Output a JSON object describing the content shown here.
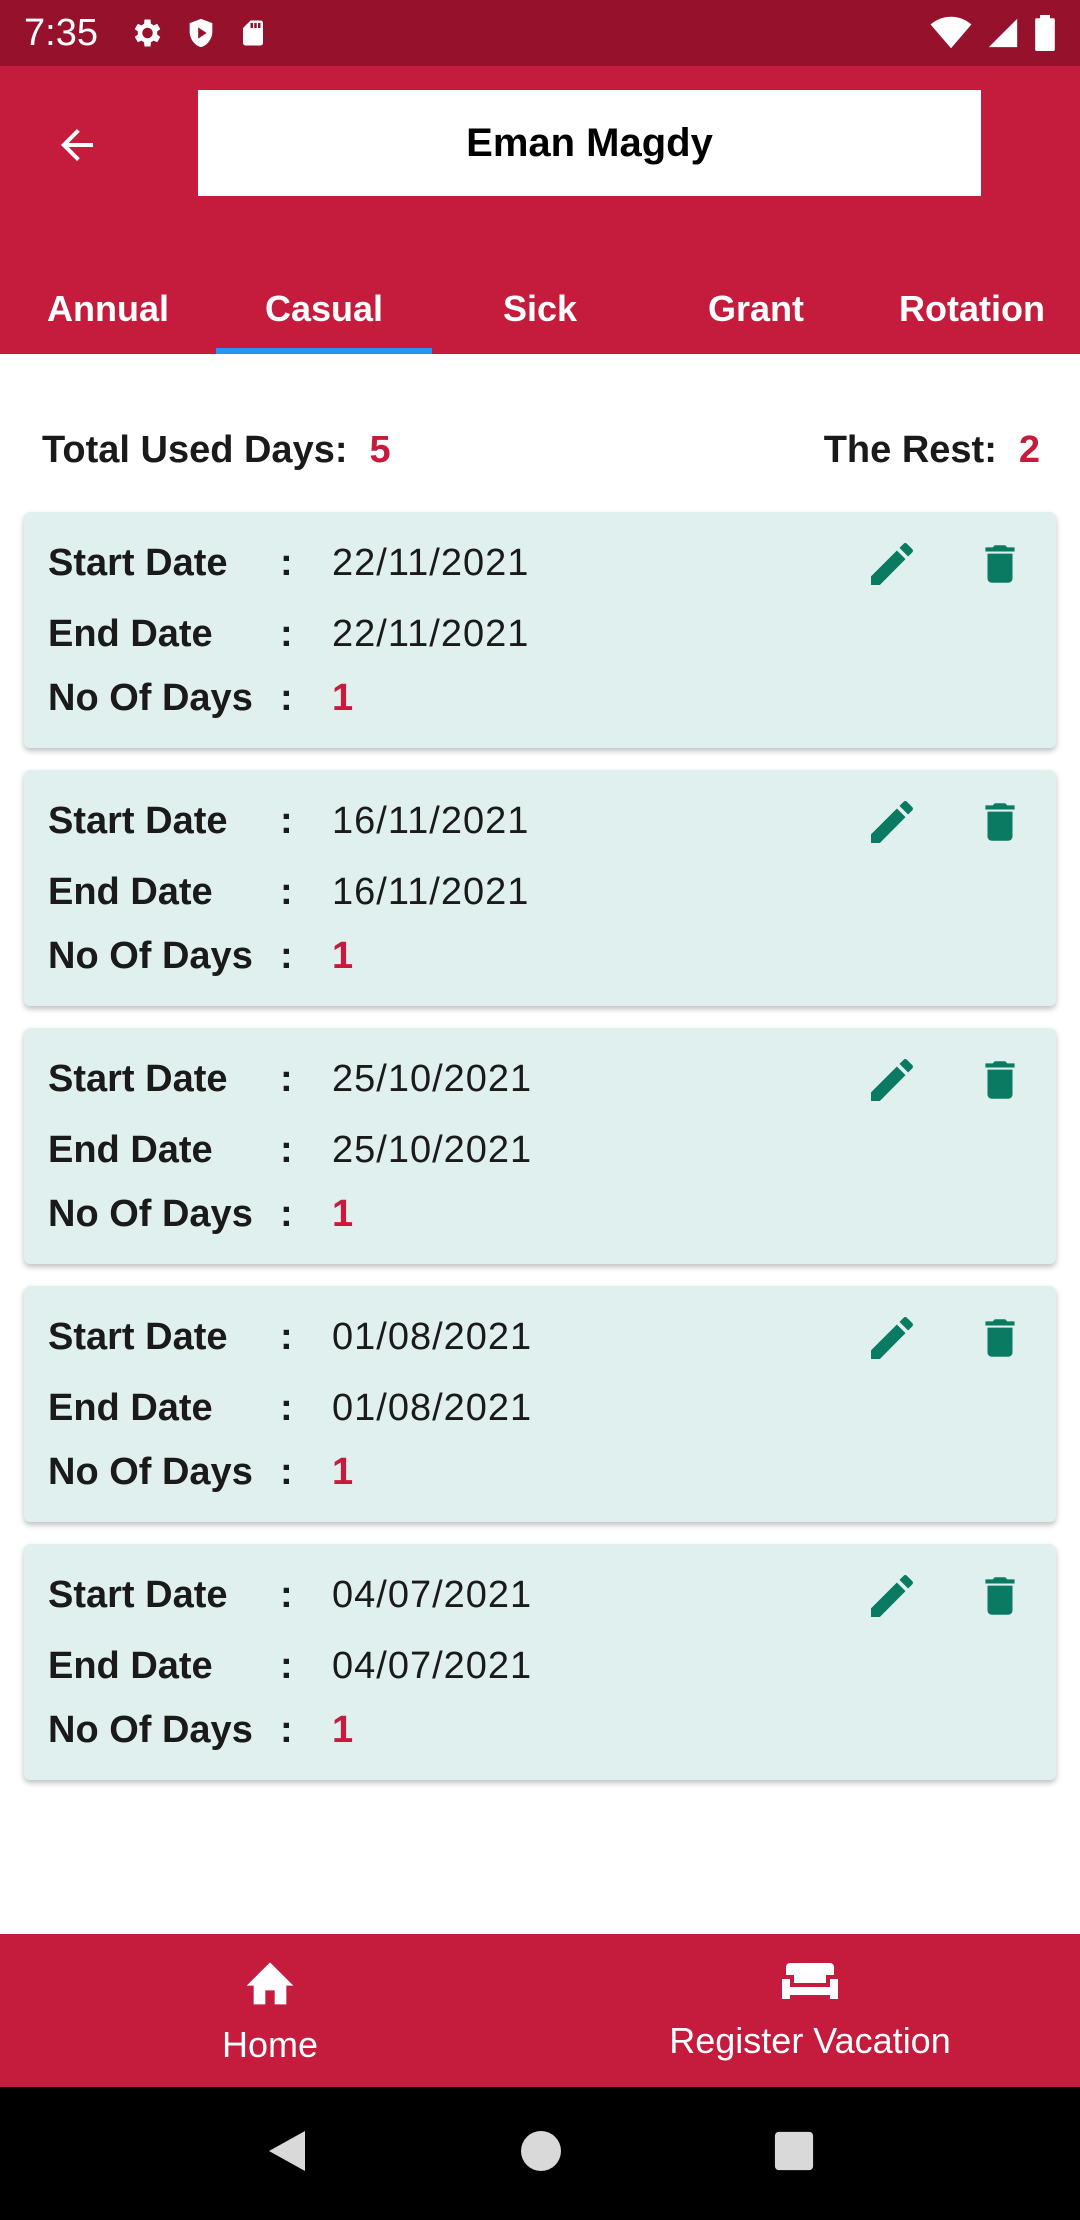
{
  "status_bar": {
    "time": "7:35",
    "left_icons": [
      "gear-icon",
      "shield-icon",
      "sd-card-icon"
    ],
    "right_icons": [
      "wifi-icon",
      "signal-icon",
      "battery-icon"
    ]
  },
  "header": {
    "title": "Eman Magdy",
    "colors": {
      "primary": "#c51b3c",
      "status": "#96122c",
      "indicator": "#2196f3"
    }
  },
  "tabs": [
    {
      "label": "Annual",
      "active": false
    },
    {
      "label": "Casual",
      "active": true
    },
    {
      "label": "Sick",
      "active": false
    },
    {
      "label": "Grant",
      "active": false
    },
    {
      "label": "Rotation",
      "active": false
    }
  ],
  "summary": {
    "used_label": "Total Used Days:",
    "used_value": "5",
    "rest_label": "The Rest:",
    "rest_value": "2"
  },
  "labels": {
    "start": "Start Date",
    "end": "End Date",
    "days": "No Of Days",
    "colon": ":"
  },
  "vacations": [
    {
      "start": "22/11/2021",
      "end": "22/11/2021",
      "days": "1"
    },
    {
      "start": "16/11/2021",
      "end": "16/11/2021",
      "days": "1"
    },
    {
      "start": "25/10/2021",
      "end": "25/10/2021",
      "days": "1"
    },
    {
      "start": "01/08/2021",
      "end": "01/08/2021",
      "days": "1"
    },
    {
      "start": "04/07/2021",
      "end": "04/07/2021",
      "days": "1"
    }
  ],
  "bottom_nav": [
    {
      "label": "Home",
      "icon": "home-icon"
    },
    {
      "label": "Register Vacation",
      "icon": "sofa-icon"
    }
  ],
  "system_nav": [
    "back-triangle-icon",
    "home-circle-icon",
    "recents-square-icon"
  ]
}
